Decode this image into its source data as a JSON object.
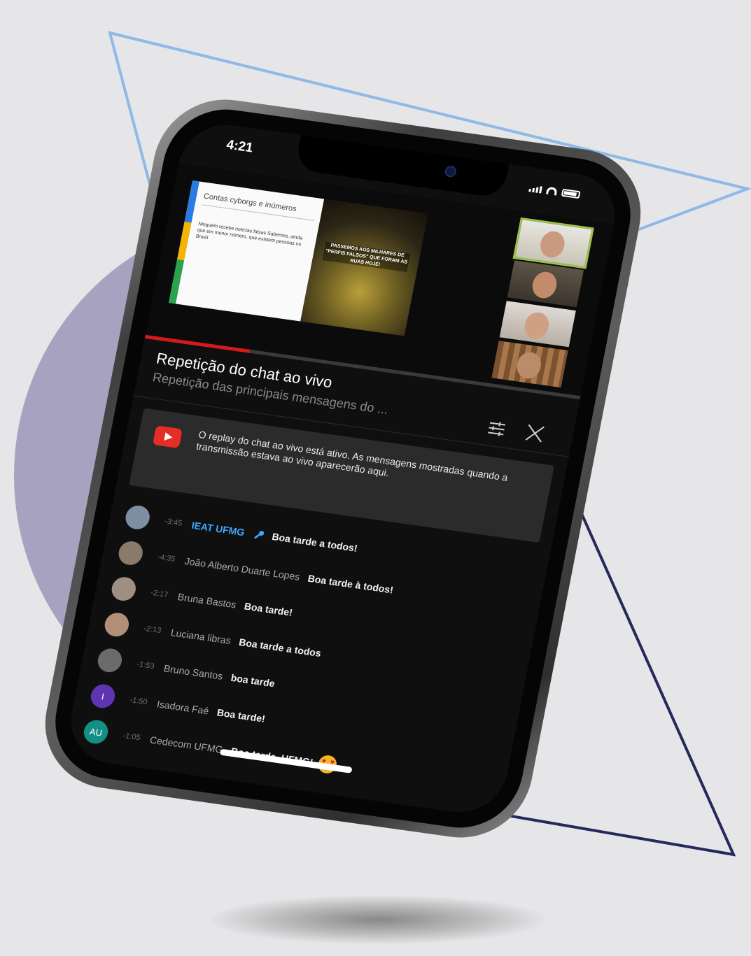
{
  "colors": {
    "background": "#e6e5e7",
    "circle": "#a7a2c0",
    "light_triangle": "#8fb9e6",
    "dark_triangle": "#24285a",
    "accent_red": "#d61a1a",
    "owner_blue": "#3ea6ff"
  },
  "status_bar": {
    "time": "4:21",
    "icons": [
      "signal-icon",
      "wifi-icon",
      "battery-icon"
    ]
  },
  "video": {
    "slide_title": "Contas cyborgs e inúmeros",
    "slide_text": "Ninguém recebe notícias falsas Sabemos, ainda que em menor número, que existem pessoas no Brasil",
    "crowd_caption": "PASSEMOS AOS MILHARES DE \"PERFIS FALSOS\" QUE FORAM ÀS RUAS HOJE!",
    "progress": 0.24
  },
  "chat": {
    "title": "Repetição do chat ao vivo",
    "subtitle": "Repetição das principais mensagens do ...",
    "banner_text": "O replay do chat ao vivo está ativo. As mensagens mostradas quando a transmissão estava ao vivo aparecerão aqui.",
    "messages": [
      {
        "time": "-3:45",
        "author": "IEAT UFMG",
        "text": "Boa tarde a todos!",
        "owner": true,
        "avatar_color": "#7f8fa3",
        "initial": ""
      },
      {
        "time": "-4:35",
        "author": "João Alberto Duarte Lopes",
        "text": "Boa tarde à todos!",
        "owner": false,
        "avatar_color": "#8a7a6a",
        "initial": ""
      },
      {
        "time": "-2:17",
        "author": "Bruna Bastos",
        "text": "Boa tarde!",
        "owner": false,
        "avatar_color": "#9d8f82",
        "initial": ""
      },
      {
        "time": "-2:13",
        "author": "Luciana libras",
        "text": "Boa tarde a todos",
        "owner": false,
        "avatar_color": "#b08e78",
        "initial": ""
      },
      {
        "time": "-1:53",
        "author": "Bruno Santos",
        "text": "boa tarde",
        "owner": false,
        "avatar_color": "#6b6b6b",
        "initial": ""
      },
      {
        "time": "-1:50",
        "author": "Isadora Faé",
        "text": "Boa tarde!",
        "owner": false,
        "avatar_color": "#5e35b1",
        "initial": "I"
      },
      {
        "time": "-1:05",
        "author": "Cedecom UFMG",
        "text": "Boa tarde, UFMG!",
        "owner": false,
        "avatar_color": "#138f86",
        "initial": "AU",
        "emoji": "heart-eyes-emoji"
      }
    ]
  }
}
